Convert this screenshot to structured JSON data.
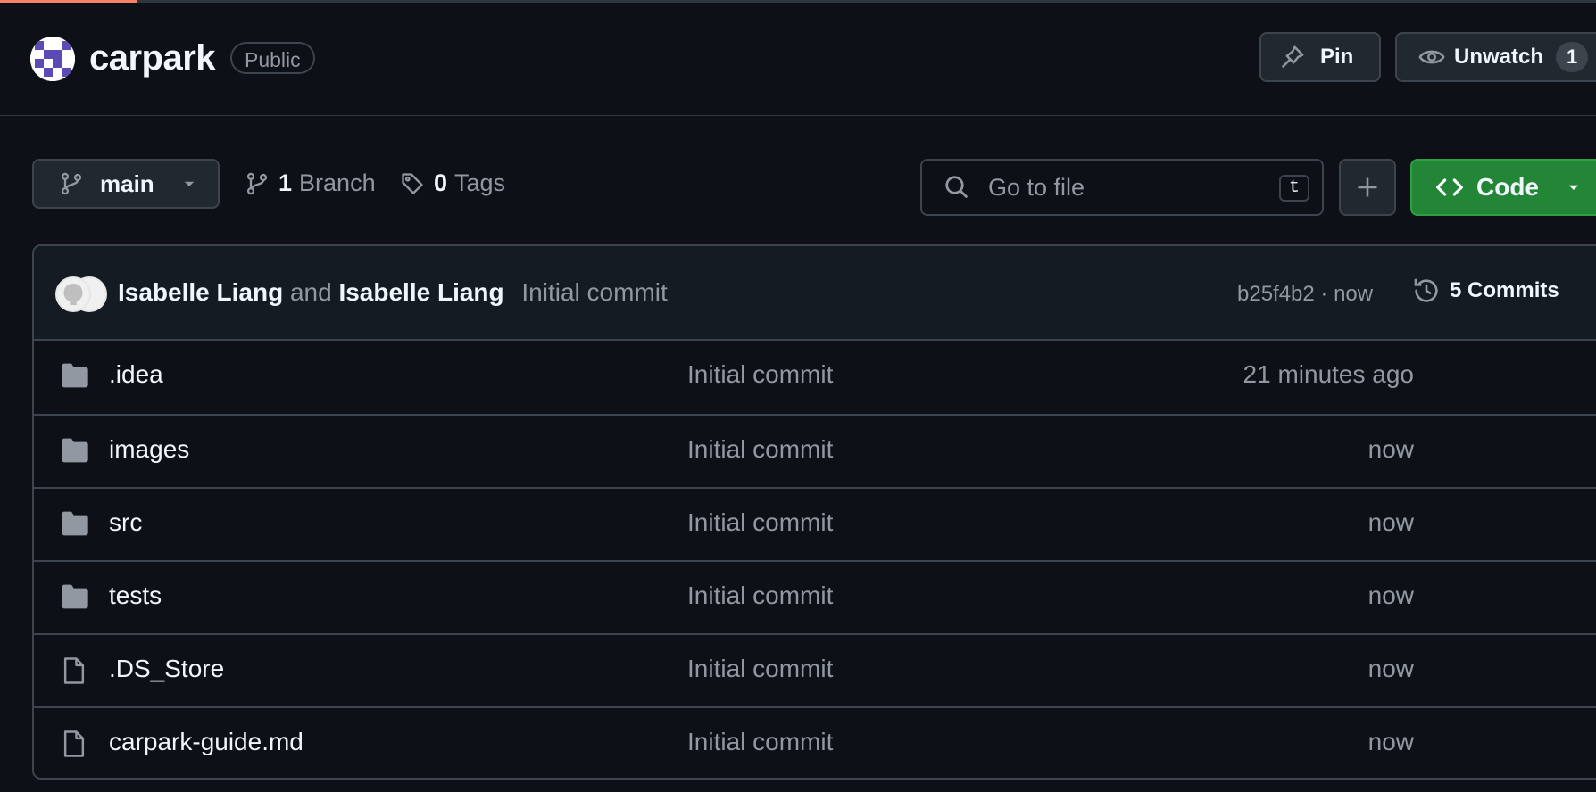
{
  "repo": {
    "name": "carpark",
    "visibility": "Public"
  },
  "actions": {
    "pin_label": "Pin",
    "watch_label": "Unwatch",
    "watch_count": "1"
  },
  "toolbar": {
    "branch": "main",
    "branch_count": "1",
    "branch_label": "Branch",
    "tag_count": "0",
    "tag_label": "Tags",
    "search_placeholder": "Go to file",
    "search_shortcut": "t",
    "code_label": "Code"
  },
  "latest_commit": {
    "author1": "Isabelle Liang",
    "joiner": "and",
    "author2": "Isabelle Liang",
    "message": "Initial commit",
    "hash_time": "b25f4b2 · now",
    "commits_label": "5 Commits"
  },
  "files": [
    {
      "type": "folder",
      "name": ".idea",
      "message": "Initial commit",
      "time": "21 minutes ago"
    },
    {
      "type": "folder",
      "name": "images",
      "message": "Initial commit",
      "time": "now"
    },
    {
      "type": "folder",
      "name": "src",
      "message": "Initial commit",
      "time": "now"
    },
    {
      "type": "folder",
      "name": "tests",
      "message": "Initial commit",
      "time": "now"
    },
    {
      "type": "file",
      "name": ".DS_Store",
      "message": "Initial commit",
      "time": "now"
    },
    {
      "type": "file",
      "name": "carpark-guide.md",
      "message": "Initial commit",
      "time": "now"
    }
  ],
  "colors": {
    "background": "#0d1117",
    "accent_tab": "#f78166",
    "code_button": "#238636",
    "muted_text": "#9198a1"
  }
}
